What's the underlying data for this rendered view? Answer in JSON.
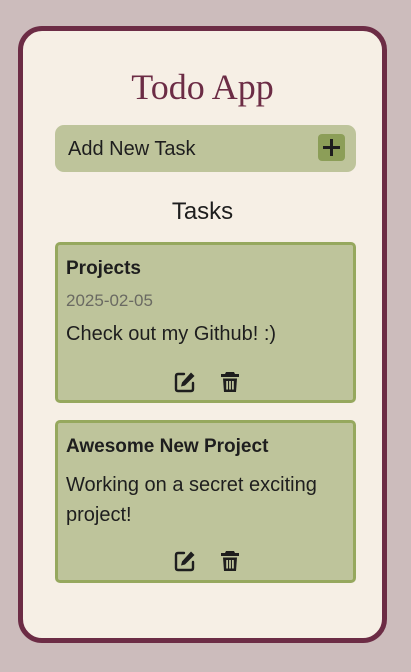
{
  "app": {
    "title": "Todo App"
  },
  "add_task": {
    "label": "Add New Task",
    "icon": "plus-icon"
  },
  "tasks_section": {
    "title": "Tasks"
  },
  "tasks": [
    {
      "title": "Projects",
      "date": "2025-02-05",
      "description": "Check out my Github! :)"
    },
    {
      "title": "Awesome New Project",
      "description": "Working on a secret exciting project!"
    }
  ],
  "icons": {
    "edit": "edit-icon",
    "delete": "trash-icon"
  },
  "colors": {
    "page_background": "#ccbcbc",
    "app_background": "#f6efe5",
    "accent": "#6c2c45",
    "card_background": "#bec49b",
    "card_border": "#96a85e",
    "add_button": "#8c9e58"
  }
}
